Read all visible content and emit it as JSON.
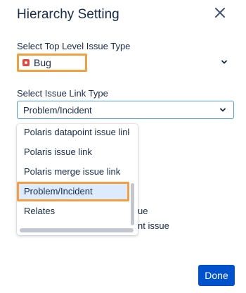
{
  "dialog": {
    "title": "Hierarchy Setting"
  },
  "top_level": {
    "label": "Select Top Level Issue Type",
    "value": "Bug",
    "icon": "bug-icon"
  },
  "link_type": {
    "label": "Select Issue Link Type",
    "value": "Problem/Incident",
    "options": [
      "Polaris datapoint issue link",
      "Polaris issue link",
      "Polaris merge issue link",
      "Problem/Incident",
      "Relates"
    ],
    "selected_index": 3
  },
  "background_text": {
    "line1": "ue",
    "line2": "nt issue"
  },
  "footer": {
    "done_label": "Done"
  },
  "colors": {
    "accent": "#0052cc",
    "highlight": "#f0a040",
    "focus": "#4c9aff",
    "selected_bg": "#deebff"
  }
}
